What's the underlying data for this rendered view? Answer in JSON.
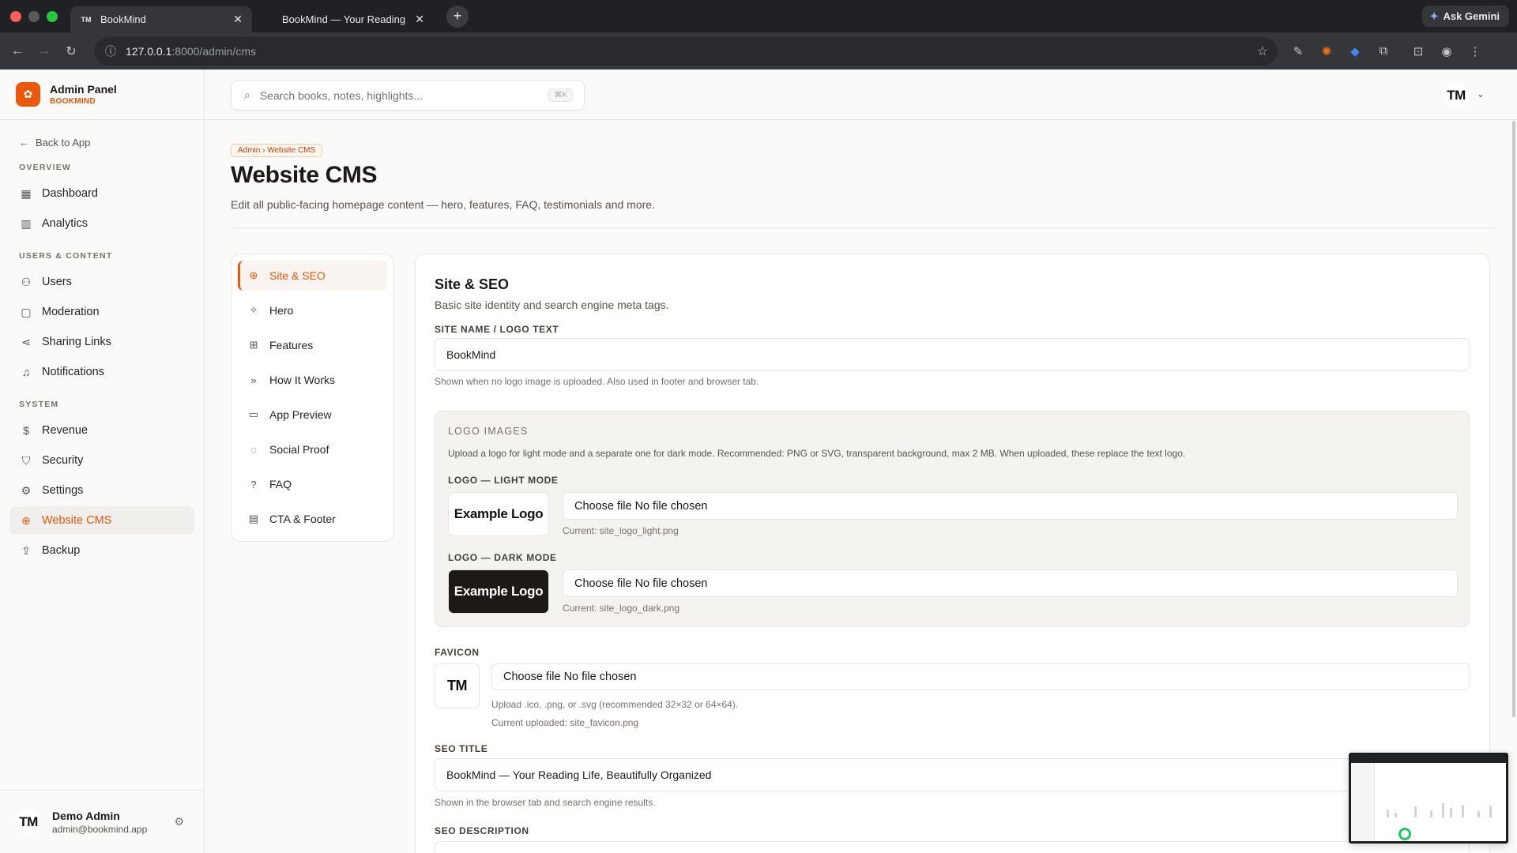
{
  "browser": {
    "tabs": [
      {
        "favicon": "TM",
        "title": "BookMind",
        "active": true
      },
      {
        "favicon": "",
        "title": "BookMind — Your Reading Lif",
        "active": false
      }
    ],
    "new_tab": "+",
    "ask_gemini": "Ask Gemini",
    "url_host": "127.0.0.1",
    "url_path": ":8000/admin/cms"
  },
  "sidebar": {
    "brand_title": "Admin Panel",
    "brand_subtitle": "BOOKMIND",
    "back_label": "Back to App",
    "sections": [
      {
        "title": "OVERVIEW",
        "items": [
          {
            "label": "Dashboard",
            "icon": "dashboard-icon"
          },
          {
            "label": "Analytics",
            "icon": "analytics-icon"
          }
        ]
      },
      {
        "title": "USERS & CONTENT",
        "items": [
          {
            "label": "Users",
            "icon": "users-icon"
          },
          {
            "label": "Moderation",
            "icon": "moderation-icon"
          },
          {
            "label": "Sharing Links",
            "icon": "share-icon"
          },
          {
            "label": "Notifications",
            "icon": "bell-icon"
          }
        ]
      },
      {
        "title": "SYSTEM",
        "items": [
          {
            "label": "Revenue",
            "icon": "dollar-icon"
          },
          {
            "label": "Security",
            "icon": "shield-icon"
          },
          {
            "label": "Settings",
            "icon": "gear-icon"
          },
          {
            "label": "Website CMS",
            "icon": "globe-icon",
            "active": true
          },
          {
            "label": "Backup",
            "icon": "upload-icon"
          }
        ]
      }
    ],
    "user": {
      "initials": "TM",
      "name": "Demo Admin",
      "email": "admin@bookmind.app"
    }
  },
  "header": {
    "search_placeholder": "Search books, notes, highlights...",
    "search_shortcut": "⌘K",
    "avatar_initials": "TM"
  },
  "page": {
    "breadcrumb": "Admin › Website CMS",
    "title": "Website CMS",
    "subtitle": "Edit all public-facing homepage content — hero, features, FAQ, testimonials and more."
  },
  "cms_nav": [
    {
      "label": "Site & SEO",
      "icon": "globe-icon",
      "active": true
    },
    {
      "label": "Hero",
      "icon": "sparkle-icon"
    },
    {
      "label": "Features",
      "icon": "grid-icon"
    },
    {
      "label": "How It Works",
      "icon": "chevrons-right-icon"
    },
    {
      "label": "App Preview",
      "icon": "monitor-icon"
    },
    {
      "label": "Social Proof",
      "icon": "message-icon"
    },
    {
      "label": "FAQ",
      "icon": "help-circle-icon"
    },
    {
      "label": "CTA & Footer",
      "icon": "credit-card-icon"
    }
  ],
  "site_seo": {
    "title": "Site & SEO",
    "subtitle": "Basic site identity and search engine meta tags.",
    "site_name_label": "SITE NAME / LOGO TEXT",
    "site_name_value": "BookMind",
    "site_name_help": "Shown when no logo image is uploaded. Also used in footer and browser tab.",
    "logo_images": {
      "title": "LOGO IMAGES",
      "description": "Upload a logo for light mode and a separate one for dark mode. Recommended: PNG or SVG, transparent background, max 2 MB. When uploaded, these replace the text logo.",
      "light_label": "LOGO — LIGHT MODE",
      "light_preview": "Example Logo",
      "light_file": "Choose file No file chosen",
      "light_current": "Current: site_logo_light.png",
      "dark_label": "LOGO — DARK MODE",
      "dark_preview": "Example Logo",
      "dark_file": "Choose file No file chosen",
      "dark_current": "Current: site_logo_dark.png"
    },
    "favicon": {
      "label": "FAVICON",
      "preview": "TM",
      "file": "Choose file No file chosen",
      "help": "Upload .ico, .png, or .svg (recommended 32×32 or 64×64).",
      "current": "Current uploaded: site_favicon.png"
    },
    "seo_title_label": "SEO TITLE",
    "seo_title_value": "BookMind — Your Reading Life, Beautifully Organized",
    "seo_title_help": "Shown in the browser tab and search engine results.",
    "seo_description_label": "SEO DESCRIPTION"
  },
  "colors": {
    "accent": "#ea580c",
    "chrome_dark": "#202124",
    "chrome_toolbar": "#35363a"
  }
}
